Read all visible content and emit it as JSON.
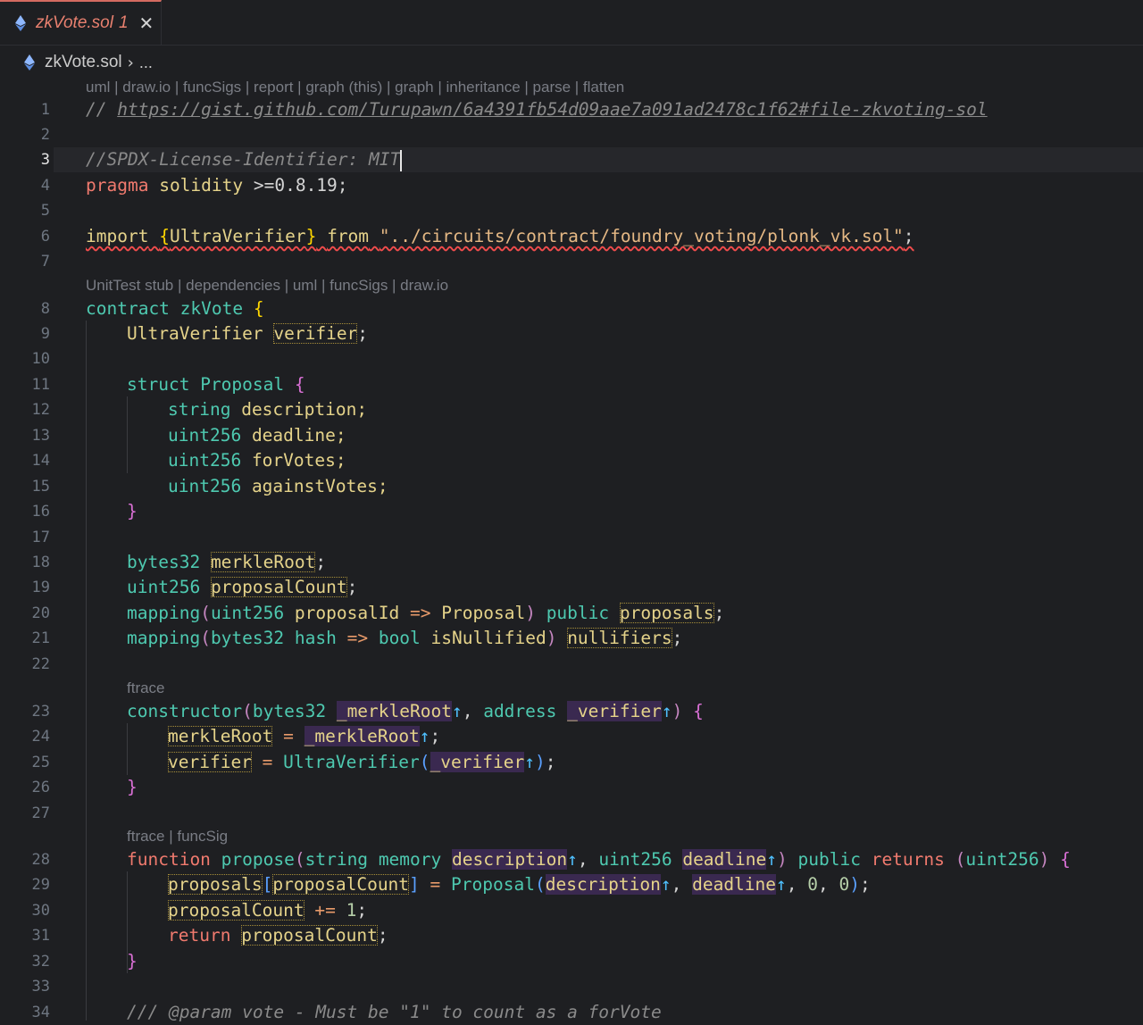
{
  "tab": {
    "filename": "zkVote.sol",
    "problem_count": "1",
    "close_glyph": "✕",
    "icon": "ethereum-icon"
  },
  "breadcrumb": {
    "file": "zkVote.sol",
    "separator": "›",
    "more": "..."
  },
  "codelens": {
    "top": "uml | draw.io | funcSigs | report | graph (this) | graph | inheritance | parse | flatten",
    "contract": "UnitTest stub | dependencies | uml | funcSigs | draw.io",
    "constructor": "ftrace",
    "propose": "ftrace | funcSig"
  },
  "lines": {
    "n1": "1",
    "n2": "2",
    "n3": "3",
    "n4": "4",
    "n5": "5",
    "n6": "6",
    "n7": "7",
    "n8": "8",
    "n9": "9",
    "n10": "10",
    "n11": "11",
    "n12": "12",
    "n13": "13",
    "n14": "14",
    "n15": "15",
    "n16": "16",
    "n17": "17",
    "n18": "18",
    "n19": "19",
    "n20": "20",
    "n21": "21",
    "n22": "22",
    "n23": "23",
    "n24": "24",
    "n25": "25",
    "n26": "26",
    "n27": "27",
    "n28": "28",
    "n29": "29",
    "n30": "30",
    "n31": "31",
    "n32": "32",
    "n33": "33",
    "n34": "34"
  },
  "code": {
    "l1_slash": "// ",
    "l1_url": "https://gist.github.com/Turupawn/6a4391fb54d09aae7a091ad2478c1f62#file-zkvoting-sol",
    "l3": "//SPDX-License-Identifier: MIT",
    "l4_kw": "pragma",
    "l4_sol": "solidity",
    "l4_ver": " >=0.8.19;",
    "l6_import": "import",
    "l6_brace_open": "{",
    "l6_name": "UltraVerifier",
    "l6_brace_close": "}",
    "l6_from": "from",
    "l6_path": "\"../circuits/contract/foundry_voting/plonk_vk.sol\"",
    "l6_semi": ";",
    "l8_kw": "contract",
    "l8_name": "zkVote",
    "l8_brace": "{",
    "l9_type": "UltraVerifier",
    "l9_var": "verifier",
    "l11_kw": "struct",
    "l11_name": "Proposal",
    "l11_brace": "{",
    "l12_type": "string",
    "l12_var": "description;",
    "l13_type": "uint256",
    "l13_var": "deadline;",
    "l14_type": "uint256",
    "l14_var": "forVotes;",
    "l15_type": "uint256",
    "l15_var": "againstVotes;",
    "l16_brace": "}",
    "l18_type": "bytes32",
    "l18_var": "merkleRoot",
    "l19_type": "uint256",
    "l19_var": "proposalCount",
    "l20_map": "mapping",
    "l20_kt": "uint256",
    "l20_kn": "proposalId",
    "l20_arrow": "=>",
    "l20_vt": "Proposal",
    "l20_pub": "public",
    "l20_var": "proposals",
    "l21_map": "mapping",
    "l21_kt": "bytes32",
    "l21_kn": "hash",
    "l21_arrow": "=>",
    "l21_vt": "bool",
    "l21_vn": "isNullified",
    "l21_var": "nullifiers",
    "l23_kw": "constructor",
    "l23_t1": "bytes32",
    "l23_p1": "_merkleRoot",
    "l23_t2": "address",
    "l23_p2": "_verifier",
    "l24_lhs": "merkleRoot",
    "l24_rhs": "_merkleRoot",
    "l25_lhs": "verifier",
    "l25_call": "UltraVerifier",
    "l25_arg": "_verifier",
    "l28_fn": "function",
    "l28_name": "propose",
    "l28_t1": "string",
    "l28_mem": "memory",
    "l28_p1": "description",
    "l28_t2": "uint256",
    "l28_p2": "deadline",
    "l28_pub": "public",
    "l28_ret": "returns",
    "l28_rt": "uint256",
    "l29_arr": "proposals",
    "l29_idx": "proposalCount",
    "l29_ctor": "Proposal",
    "l29_a1": "description",
    "l29_a2": "deadline",
    "l29_z1": "0",
    "l29_z2": "0",
    "l30_var": "proposalCount",
    "l30_op": "+=",
    "l30_one": "1",
    "l31_ret": "return",
    "l31_var": "proposalCount",
    "l34": "/// @param vote - Must be \"1\" to count as a forVote"
  }
}
